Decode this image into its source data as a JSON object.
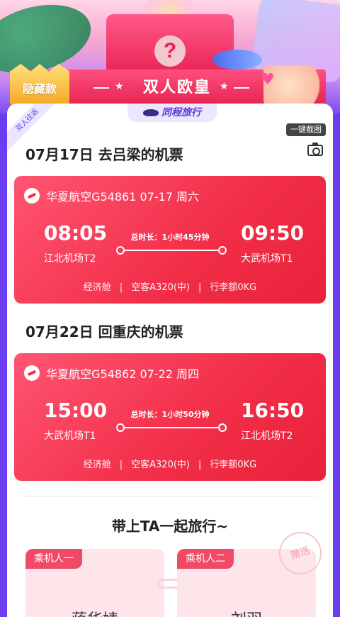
{
  "badge": "隐藏款",
  "banner_title": "双人欧皇",
  "corner_ribbon": "双人往返",
  "brand": "同程旅行",
  "screenshot_tip": "一键截图",
  "outbound": {
    "section_title": "07月17日 去吕梁的机票",
    "airline": "华夏航空G54861 07-17 周六",
    "depart_time": "08:05",
    "arrive_time": "09:50",
    "depart_airport": "江北机场T2",
    "arrive_airport": "大武机场T1",
    "duration": "总时长：1小时45分钟",
    "cabin": "经济舱",
    "aircraft": "空客A320(中)",
    "baggage": "行李额0KG"
  },
  "return": {
    "section_title": "07月22日 回重庆的机票",
    "airline": "华夏航空G54862 07-22 周四",
    "depart_time": "15:00",
    "arrive_time": "16:50",
    "depart_airport": "大武机场T1",
    "arrive_airport": "江北机场T2",
    "duration": "总时长：1小时50分钟",
    "cabin": "经济舱",
    "aircraft": "空客A320(中)",
    "baggage": "行李额0KG"
  },
  "separator": "|",
  "together_title": "带上TA一起旅行~",
  "passengers": [
    {
      "tag": "乘机人一",
      "name": "蒋华婧"
    },
    {
      "tag": "乘机人二",
      "name": "刘羽"
    }
  ],
  "gift_stamp": "赠送"
}
